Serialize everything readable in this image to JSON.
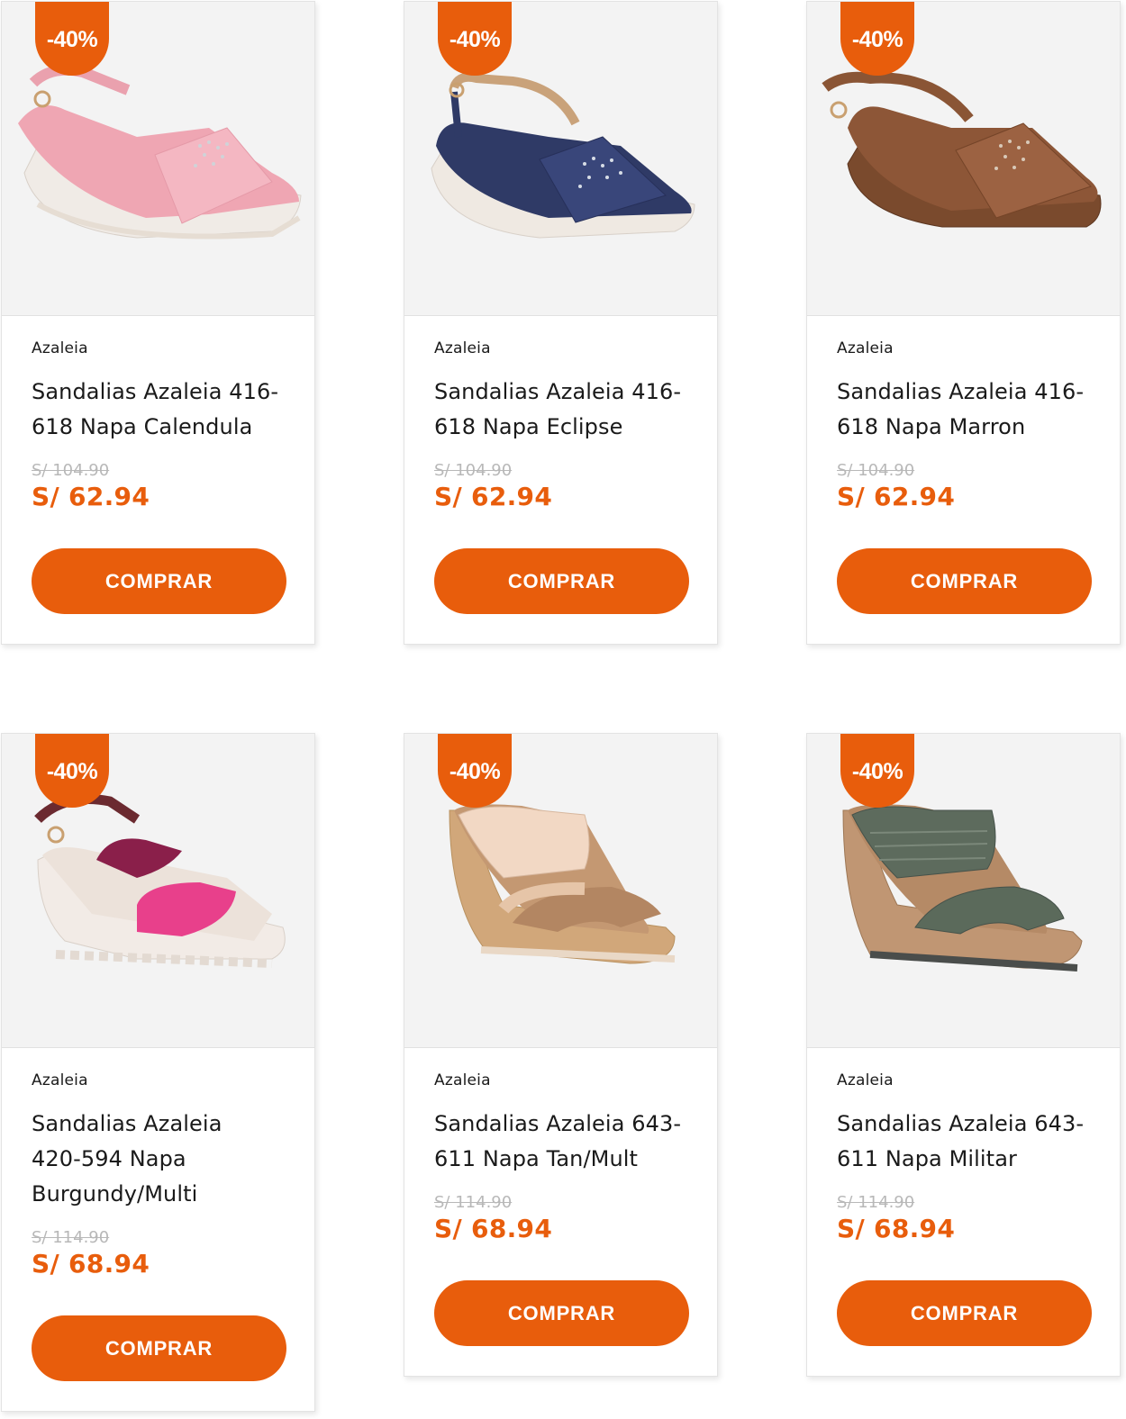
{
  "accent_color": "#e85d0c",
  "products": [
    {
      "discount": "-40%",
      "brand": "Azaleia",
      "title_line1": "Sandalias Azaleia 416-",
      "title_line2": "618 Napa Calendula",
      "title_line3": "",
      "old_price": "S/ 104.90",
      "new_price": "S/ 62.94",
      "button_label": "COMPRAR",
      "image": "pink-wedge-sandal-image"
    },
    {
      "discount": "-40%",
      "brand": "Azaleia",
      "title_line1": "Sandalias Azaleia 416-",
      "title_line2": "618 Napa Eclipse",
      "title_line3": "",
      "old_price": "S/ 104.90",
      "new_price": "S/ 62.94",
      "button_label": "COMPRAR",
      "image": "navy-wedge-sandal-image"
    },
    {
      "discount": "-40%",
      "brand": "Azaleia",
      "title_line1": "Sandalias Azaleia 416-",
      "title_line2": "618 Napa Marron",
      "title_line3": "",
      "old_price": "S/ 104.90",
      "new_price": "S/ 62.94",
      "button_label": "COMPRAR",
      "image": "brown-wedge-sandal-image"
    },
    {
      "discount": "-40%",
      "brand": "Azaleia",
      "title_line1": "Sandalias Azaleia",
      "title_line2": "420-594 Napa",
      "title_line3": "Burgundy/Multi",
      "old_price": "S/ 114.90",
      "new_price": "S/ 68.94",
      "button_label": "COMPRAR",
      "image": "burgundy-platform-sandal-image"
    },
    {
      "discount": "-40%",
      "brand": "Azaleia",
      "title_line1": "Sandalias Azaleia 643-",
      "title_line2": "611 Napa Tan/Mult",
      "title_line3": "",
      "old_price": "S/ 114.90",
      "new_price": "S/ 68.94",
      "button_label": "COMPRAR",
      "image": "tan-slide-wedge-image"
    },
    {
      "discount": "-40%",
      "brand": "Azaleia",
      "title_line1": "Sandalias Azaleia 643-",
      "title_line2": "611 Napa Militar",
      "title_line3": "",
      "old_price": "S/ 114.90",
      "new_price": "S/ 68.94",
      "button_label": "COMPRAR",
      "image": "green-slide-wedge-image"
    }
  ]
}
